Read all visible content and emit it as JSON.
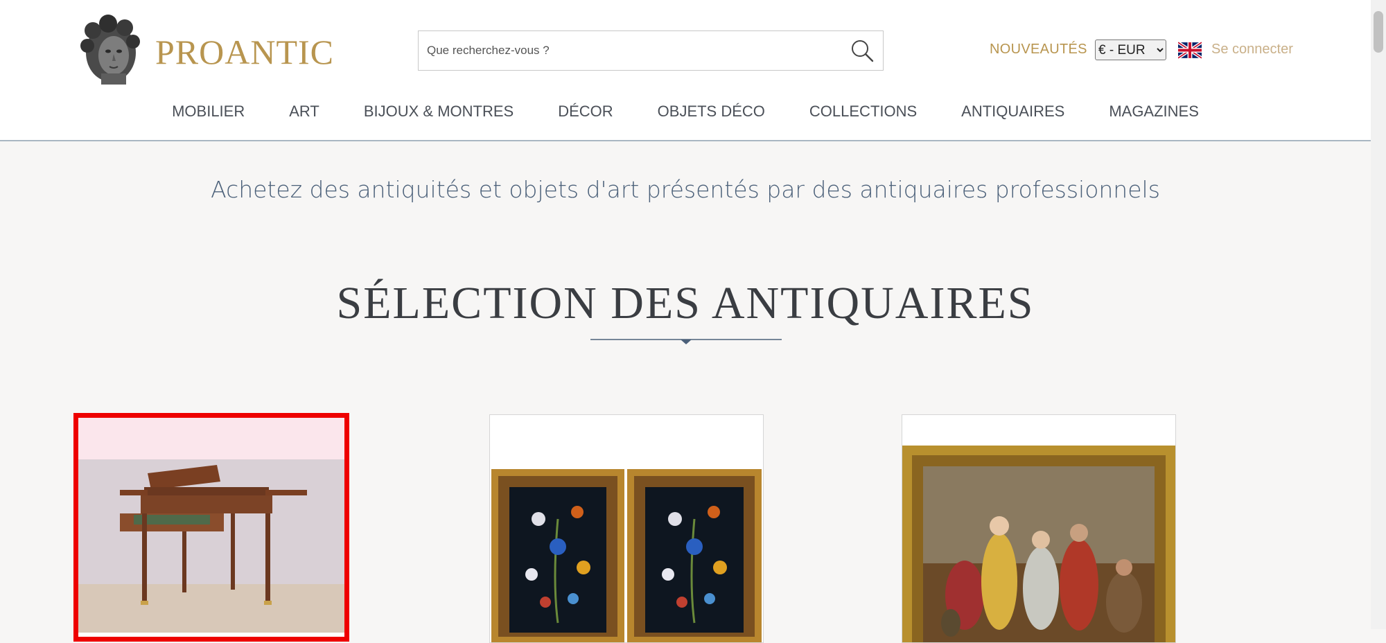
{
  "header": {
    "logo_text": "PROANTIC",
    "search": {
      "placeholder": "Que recherchez-vous ?",
      "value": ""
    },
    "new_label": "NOUVEAUTÉS",
    "currency": {
      "selected": "€ - EUR",
      "options": [
        "€ - EUR"
      ]
    },
    "language_flag": "uk-flag-icon",
    "signin_label": "Se connecter"
  },
  "nav": {
    "items": [
      {
        "label": "MOBILIER"
      },
      {
        "label": "ART"
      },
      {
        "label": "BIJOUX & MONTRES"
      },
      {
        "label": "DÉCOR"
      },
      {
        "label": "OBJETS DÉCO"
      },
      {
        "label": "COLLECTIONS"
      },
      {
        "label": "ANTIQUAIRES"
      },
      {
        "label": "MAGAZINES"
      }
    ]
  },
  "main": {
    "tagline": "Achetez des antiquités et objets d'art présentés par des antiquaires professionnels",
    "section_title": "SÉLECTION DES ANTIQUAIRES",
    "cards": [
      {
        "image": "mahogany-writing-desk-image",
        "selected": true
      },
      {
        "image": "pietra-dura-panels-pair-image",
        "selected": false
      },
      {
        "image": "old-master-painting-framed-image",
        "selected": false
      }
    ]
  },
  "colors": {
    "brand_gold": "#b8954f",
    "tagline_blue": "#4b6079",
    "selection_red": "#ee0000",
    "background": "#f7f6f5"
  }
}
